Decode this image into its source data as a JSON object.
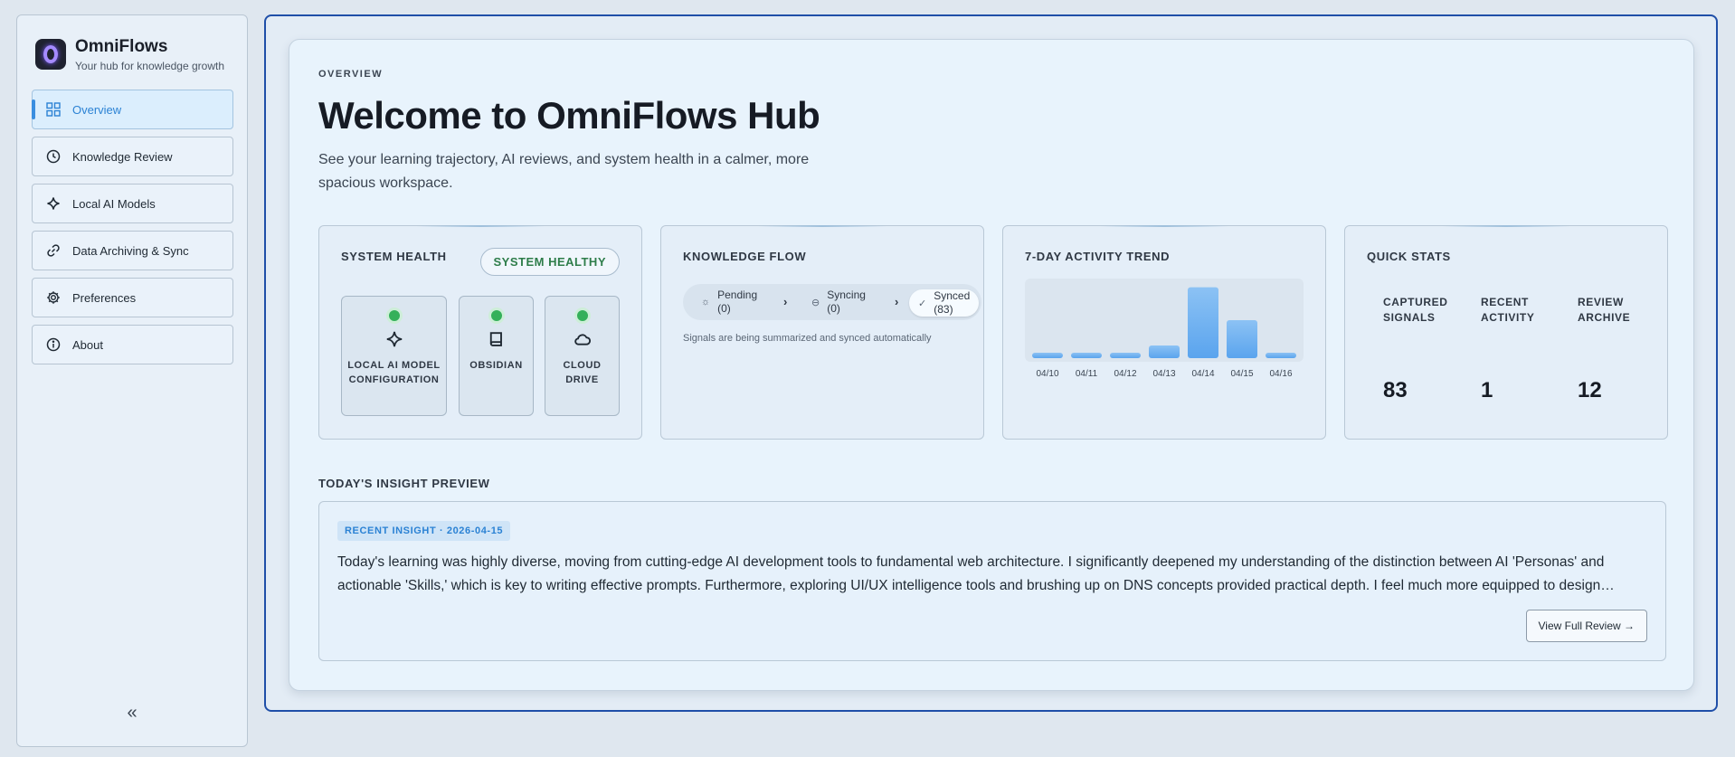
{
  "brand": {
    "name": "OmniFlows",
    "subtitle": "Your hub for knowledge growth"
  },
  "sidebar": {
    "items": [
      {
        "label": "Overview",
        "icon": "grid-icon",
        "active": true
      },
      {
        "label": "Knowledge Review",
        "icon": "clock-icon",
        "active": false
      },
      {
        "label": "Local AI Models",
        "icon": "sparkle-icon",
        "active": false
      },
      {
        "label": "Data Archiving & Sync",
        "icon": "link-icon",
        "active": false
      },
      {
        "label": "Preferences",
        "icon": "gear-icon",
        "active": false
      },
      {
        "label": "About",
        "icon": "info-icon",
        "active": false
      }
    ],
    "collapse_label": "«"
  },
  "header": {
    "eyebrow": "OVERVIEW",
    "title": "Welcome to OmniFlows Hub",
    "description": "See your learning trajectory, AI reviews, and system health in a calmer, more spacious workspace."
  },
  "system_health": {
    "title": "SYSTEM HEALTH",
    "badge": "SYSTEM HEALTHY",
    "services": [
      {
        "label": "LOCAL AI MODEL CONFIGURATION",
        "icon": "sparkle-icon",
        "status": "ok"
      },
      {
        "label": "OBSIDIAN",
        "icon": "book-icon",
        "status": "ok"
      },
      {
        "label": "CLOUD DRIVE",
        "icon": "cloud-icon",
        "status": "ok"
      }
    ]
  },
  "knowledge_flow": {
    "title": "KNOWLEDGE FLOW",
    "steps": [
      {
        "label": "Pending",
        "count": "(0)"
      },
      {
        "label": "Syncing",
        "count": "(0)"
      },
      {
        "label": "Synced",
        "count": "(83)"
      }
    ],
    "note": "Signals are being summarized and synced automatically"
  },
  "activity": {
    "title": "7-DAY ACTIVITY TREND"
  },
  "chart_data": {
    "type": "bar",
    "categories": [
      "04/10",
      "04/11",
      "04/12",
      "04/13",
      "04/14",
      "04/15",
      "04/16"
    ],
    "values": [
      2,
      2,
      2,
      5,
      28,
      15,
      2
    ],
    "ylim": [
      0,
      30
    ]
  },
  "quick_stats": {
    "title": "QUICK STATS",
    "items": [
      {
        "label": "CAPTURED SIGNALS",
        "value": "83"
      },
      {
        "label": "RECENT ACTIVITY",
        "value": "1"
      },
      {
        "label": "REVIEW ARCHIVE",
        "value": "12"
      }
    ]
  },
  "insight": {
    "section_label": "TODAY'S INSIGHT PREVIEW",
    "tag": "RECENT INSIGHT · 2026-04-15",
    "text": "Today's learning was highly diverse, moving from cutting-edge AI development tools to fundamental web architecture. I significantly deepened my understanding of the distinction between AI 'Personas' and actionable 'Skills,' which is key to writing effective prompts. Furthermore, exploring UI/UX intelligence tools and brushing up on DNS concepts provided practical depth. I feel much more equipped to design…",
    "button": "View Full Review →"
  },
  "colors": {
    "accent": "#2b82d4",
    "ok": "#35b05a",
    "bar": "#5aa4ee"
  }
}
